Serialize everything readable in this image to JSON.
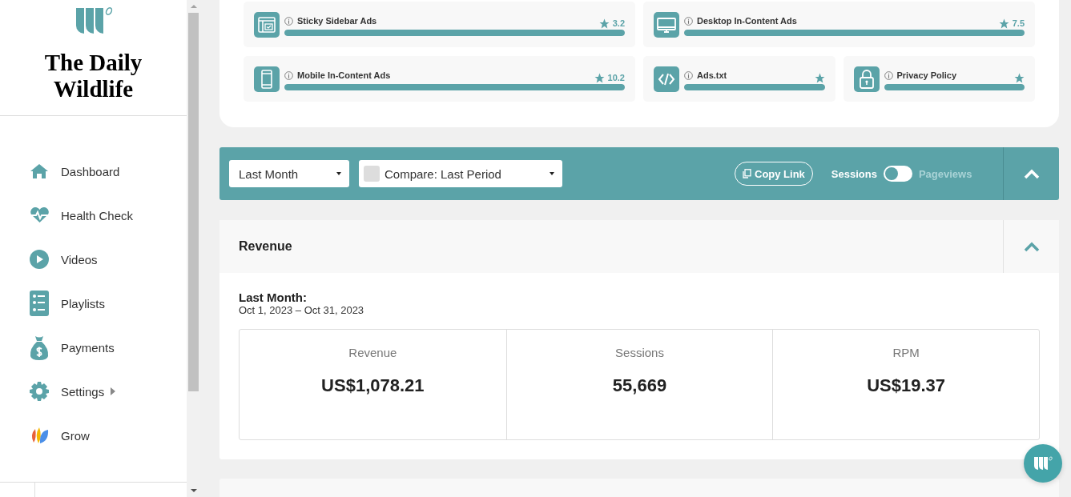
{
  "sidebar": {
    "site_title": "The Daily Wildlife",
    "nav": [
      {
        "label": "Dashboard",
        "has_submenu": false
      },
      {
        "label": "Health Check",
        "has_submenu": false
      },
      {
        "label": "Videos",
        "has_submenu": false
      },
      {
        "label": "Playlists",
        "has_submenu": false
      },
      {
        "label": "Payments",
        "has_submenu": false
      },
      {
        "label": "Settings",
        "has_submenu": true
      },
      {
        "label": "Grow",
        "has_submenu": false
      }
    ]
  },
  "health_checks": [
    {
      "label": "Sticky Sidebar Ads",
      "score": "3.2",
      "level": 1
    },
    {
      "label": "Desktop In-Content Ads",
      "score": "7.5",
      "level": 1
    },
    {
      "label": "Mobile In-Content Ads",
      "score": "10.2",
      "level": 1
    },
    {
      "label": "Ads.txt",
      "level": 1
    },
    {
      "label": "Privacy Policy",
      "level": 1
    }
  ],
  "filters": {
    "date_range": "Last Month",
    "compare": "Compare: Last Period",
    "copy_link": "Copy Link",
    "expanded": true,
    "metric_toggle": [
      {
        "label": "Sessions",
        "selected": true
      },
      {
        "label": "Pageviews",
        "selected": false
      }
    ]
  },
  "revenue": {
    "title": "Revenue",
    "expanded": true,
    "period_label": "Last Month:",
    "period_dates": "Oct 1, 2023 – Oct 31, 2023",
    "stats": [
      {
        "label": "Revenue",
        "value": "US$1,078.21"
      },
      {
        "label": "Sessions",
        "value": "55,669"
      },
      {
        "label": "RPM",
        "value": "US$19.37"
      }
    ]
  }
}
